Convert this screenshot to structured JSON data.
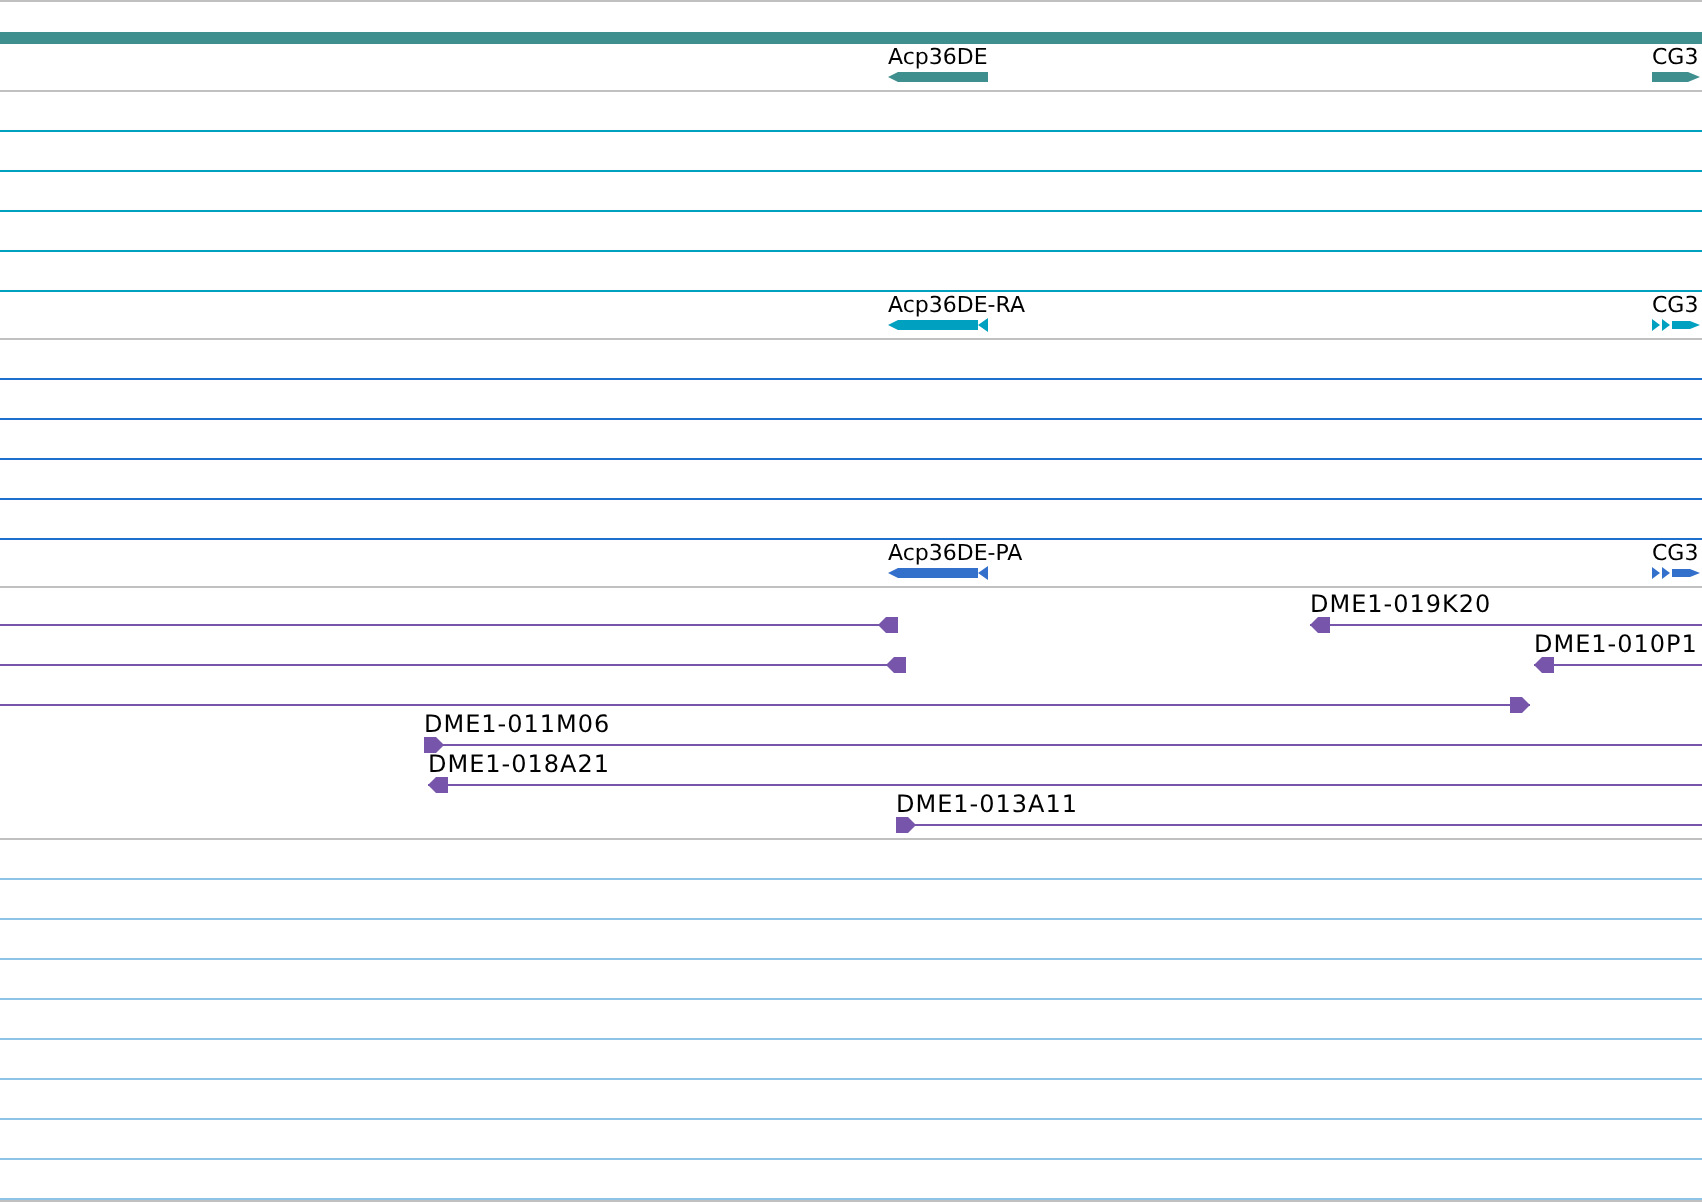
{
  "tracks": [
    {
      "kind": "gene",
      "features": [
        {
          "label": "Acp36DE",
          "reverse": true
        },
        {
          "label": "CG3",
          "reverse": false
        }
      ]
    },
    {
      "kind": "transcript",
      "features": [
        {
          "label": "Acp36DE-RA",
          "reverse": true
        },
        {
          "label": "CG3",
          "reverse": false
        }
      ]
    },
    {
      "kind": "protein",
      "features": [
        {
          "label": "Acp36DE-PA",
          "reverse": true
        },
        {
          "label": "CG3",
          "reverse": false
        }
      ]
    },
    {
      "kind": "clone",
      "rows": [
        [
          {
            "reverse": true
          },
          {
            "label": "DME1-019K20",
            "reverse": true
          }
        ],
        [
          {
            "reverse": true
          },
          {
            "label": "DME1-010P1",
            "reverse": true
          }
        ],
        [
          {
            "reverse": false
          }
        ],
        [
          {
            "label": "DME1-011M06",
            "reverse": false
          }
        ],
        [
          {
            "label": "DME1-018A21",
            "reverse": true
          }
        ],
        [
          {
            "label": "DME1-013A11",
            "reverse": false
          }
        ]
      ]
    }
  ]
}
